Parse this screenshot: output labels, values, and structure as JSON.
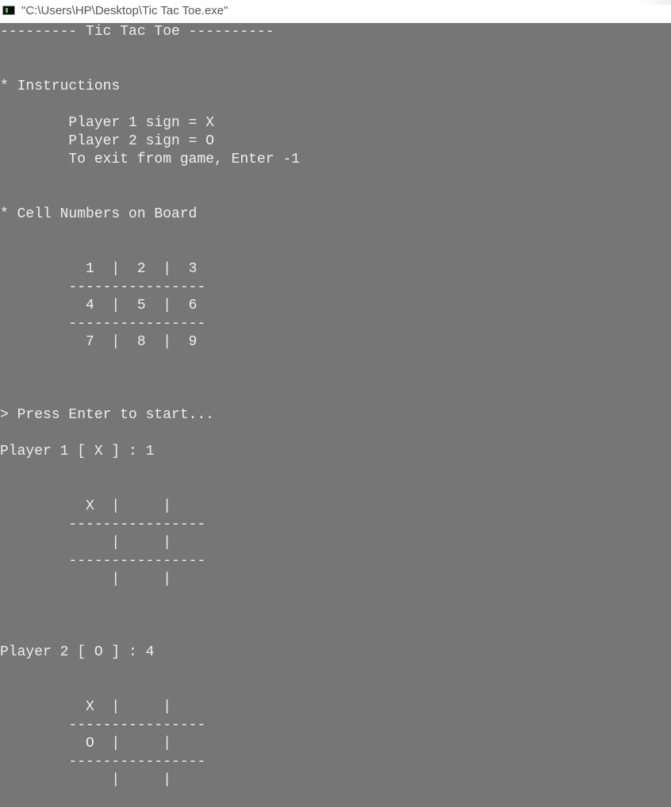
{
  "window": {
    "title": "\"C:\\Users\\HP\\Desktop\\Tic Tac Toe.exe\"",
    "icon": "console-app-icon"
  },
  "console": {
    "header": "--------- Tic Tac Toe ----------",
    "instructions": {
      "heading": "* Instructions",
      "player1_sign": "        Player 1 sign = X",
      "player2_sign": "        Player 2 sign = O",
      "exit_hint": "        To exit from game, Enter -1"
    },
    "cell_numbers": {
      "heading": "* Cell Numbers on Board",
      "row1": "          1  |  2  |  3",
      "sep1": "        ----------------",
      "row2": "          4  |  5  |  6",
      "sep2": "        ----------------",
      "row3": "          7  |  8  |  9"
    },
    "prompt": "> Press Enter to start...",
    "turns": [
      {
        "label": "Player 1 [ X ] : 1",
        "row1": "          X  |     |",
        "sep1": "        ----------------",
        "row2": "             |     |",
        "sep2": "        ----------------",
        "row3": "             |     |"
      },
      {
        "label": "Player 2 [ O ] : 4",
        "row1": "          X  |     |",
        "sep1": "        ----------------",
        "row2": "          O  |     |",
        "sep2": "        ----------------",
        "row3": "             |     |"
      }
    ]
  }
}
